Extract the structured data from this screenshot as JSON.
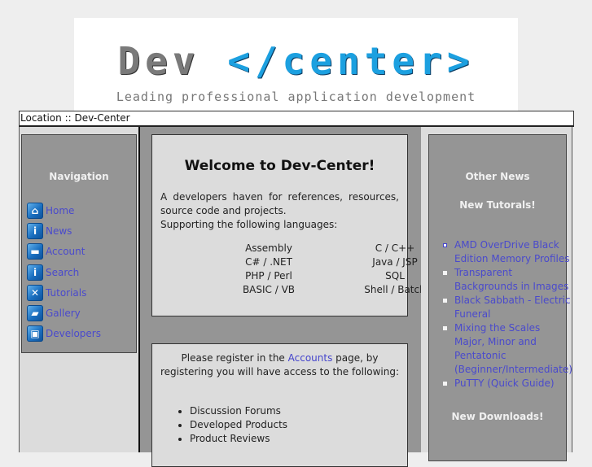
{
  "banner": {
    "logo_part1": "Dev",
    "logo_part2": "</center>",
    "tagline": "Leading professional application development",
    "colors": {
      "logo_gray": "#7a7a7a",
      "logo_blue": "#1ca0e0"
    }
  },
  "location": {
    "text": "Location :: Dev-Center"
  },
  "navigation": {
    "title": "Navigation",
    "items": [
      {
        "label": "Home",
        "icon": "home-icon"
      },
      {
        "label": "News",
        "icon": "info-bubble-icon"
      },
      {
        "label": "Account",
        "icon": "folder-icon"
      },
      {
        "label": "Search",
        "icon": "info-icon"
      },
      {
        "label": "Tutorials",
        "icon": "tools-icon"
      },
      {
        "label": "Gallery",
        "icon": "open-folder-icon"
      },
      {
        "label": "Developers",
        "icon": "monitor-icon"
      }
    ]
  },
  "welcome": {
    "title": "Welcome to Dev-Center!",
    "line1": "A developers haven for references, resources, source code and projects.",
    "line2": "Supporting the following languages:",
    "languages": [
      [
        "Assembly",
        "C / C++"
      ],
      [
        "C# / .NET",
        "Java / JSP"
      ],
      [
        "PHP / Perl",
        "SQL"
      ],
      [
        "BASIC / VB",
        "Shell / Batch"
      ]
    ]
  },
  "register": {
    "text_before": "Please register in the ",
    "link": "Accounts",
    "text_after": " page, by registering you will have access to the following:",
    "benefits": [
      "Discussion Forums",
      "Developed Products",
      "Product Reviews"
    ]
  },
  "other_news": {
    "title": "Other News",
    "tutorials_heading": "New Tutorals!",
    "tutorials": [
      [
        "AMD OverDrive Black",
        "Edition Memory Profiles"
      ],
      [
        "Transparent",
        "Backgrounds in Images"
      ],
      [
        "Black Sabbath - Electric",
        "Funeral"
      ],
      [
        "Mixing the Scales",
        "Major, Minor and",
        "Pentatonic",
        "(Beginner/Intermediate)"
      ],
      [
        "PuTTY (Quick Guide)"
      ]
    ],
    "downloads_heading": "New Downloads!"
  },
  "colors": {
    "page_bg": "#eeeeee",
    "panel_dark": "#959595",
    "panel_light": "#dcdcdc",
    "link": "#4a4acc"
  }
}
